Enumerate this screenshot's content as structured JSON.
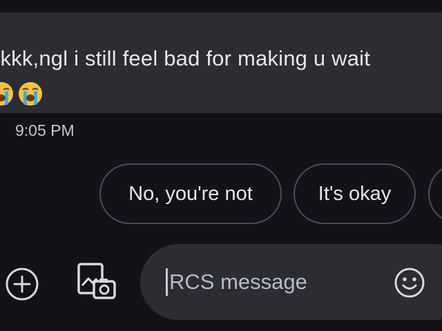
{
  "message": {
    "text": "okkk,ngl i still feel bad for making u wait",
    "emojis": [
      "loudly-crying-face-icon",
      "loudly-crying-face-icon"
    ],
    "timestamp": "9:05 PM"
  },
  "smart_replies": [
    "No, you're not",
    "It's okay",
    ""
  ],
  "compose": {
    "placeholder": "RCS message",
    "icons": [
      "plus-circle-icon",
      "gallery-add-icon",
      "emoji-smiley-icon"
    ]
  },
  "colors": {
    "background": "#121318",
    "bubble": "#2b2d33",
    "text": "#e6e6ea",
    "chip_border": "#4a4c53",
    "emoji_yellow": "#f6c23e",
    "emoji_tears": "#3da9f5"
  }
}
